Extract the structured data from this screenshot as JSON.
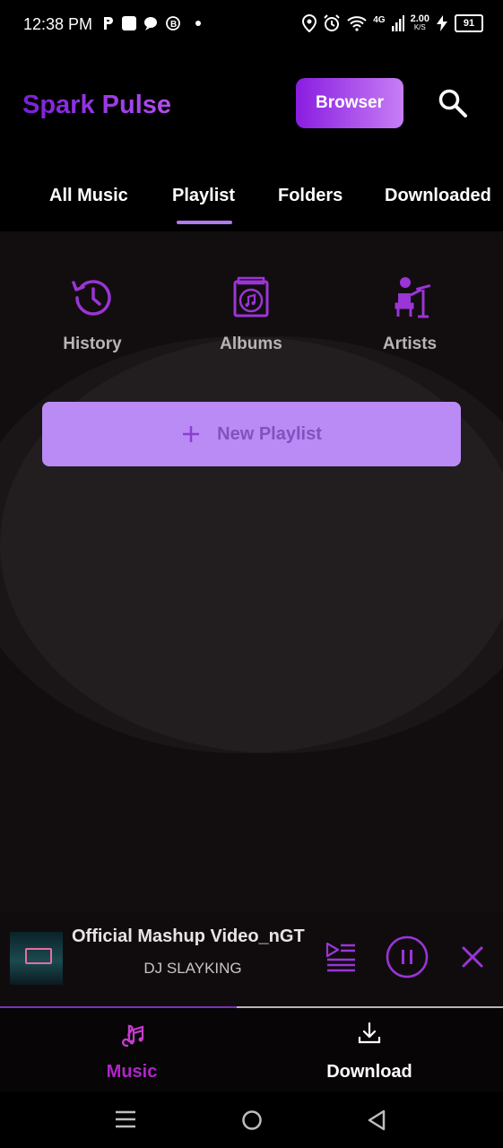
{
  "status_bar": {
    "time": "12:38 PM",
    "network": "4G",
    "speed_value": "2.00",
    "speed_unit": "K/S",
    "battery": "91"
  },
  "app": {
    "title": "Spark Pulse",
    "browser_label": "Browser",
    "search_icon": "search-icon"
  },
  "tabs": [
    {
      "label": "All Music"
    },
    {
      "label": "Playlist",
      "active": true
    },
    {
      "label": "Folders"
    },
    {
      "label": "Downloaded"
    }
  ],
  "shortcuts": [
    {
      "label": "History",
      "icon": "history-icon"
    },
    {
      "label": "Albums",
      "icon": "album-icon"
    },
    {
      "label": "Artists",
      "icon": "artist-icon"
    }
  ],
  "new_playlist": {
    "icon": "plus-icon",
    "label": "New Playlist"
  },
  "player": {
    "title": "Official Mashup Video_nGT",
    "artist": "DJ SLAYKING",
    "progress": 0.47
  },
  "bottom_nav": [
    {
      "label": "Music",
      "icon": "music-note-icon",
      "active": true
    },
    {
      "label": "Download",
      "icon": "download-icon"
    }
  ],
  "colors": {
    "accent": "#9a35d6",
    "accent_light": "#b87ef5",
    "background": "#120d0f"
  }
}
